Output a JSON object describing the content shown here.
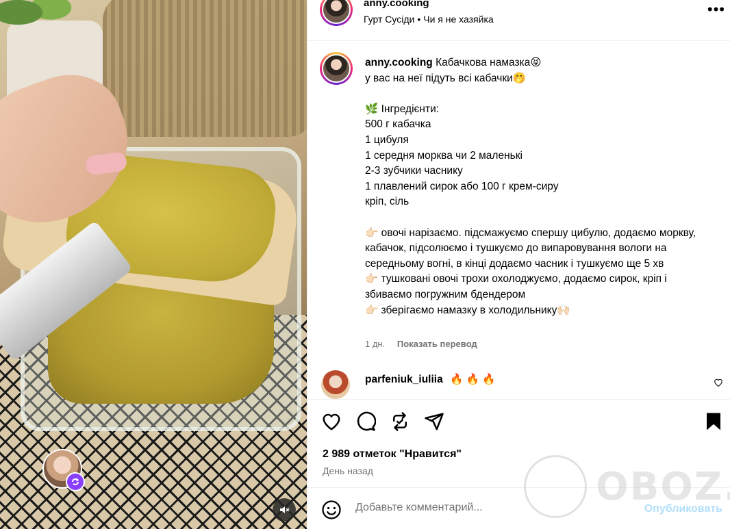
{
  "post": {
    "username": "anny.cooking",
    "group": "Гурт Сусіди",
    "group_separator": "•",
    "audio": "Чи я не хазяйка",
    "caption_title": "Кабачкова намазка😝",
    "caption_body": "у вас на неї підуть всі кабачки🤭\n\n🌿 Інгредієнти:\n500 г кабачка\n1 цибуля\n1 середня морква чи 2 маленькі\n2-3 зубчики часнику\n1 плавлений сирок або 100 г крем-сиру\nкріп, сіль\n\n👉🏻 овочі нарізаємо. підсмажуємо спершу цибулю, додаємо моркву, кабачок, підсолюємо і тушкуємо до випаровування вологи на середньому вогні, в кінці додаємо часник і тушкуємо ще 5 хв\n👉🏻 тушковані овочі трохи охолоджуємо, додаємо сирок, кріп і збиваємо погружним бдендером\n👉🏻 зберігаємо намазку в холодильнику🙌🏻",
    "caption_age": "1 дн.",
    "translate_label": "Показать перевод"
  },
  "comment": {
    "username": "parfeniuk_iuliia",
    "text": "🔥 🔥 🔥"
  },
  "stats": {
    "likes": "2 989 отметок \"Нравится\"",
    "time": "День назад"
  },
  "composer": {
    "placeholder": "Добавьте комментарий...",
    "post_label": "Опубликовать"
  },
  "watermark": {
    "text": "OBOZ.UA"
  },
  "icons": {
    "more": "more-icon",
    "like": "heart-icon",
    "comment": "comment-icon",
    "share": "repost-icon",
    "send": "send-icon",
    "save": "bookmark-icon",
    "emoji": "emoji-icon",
    "mute": "muted-speaker-icon",
    "remix": "remix-icon"
  }
}
